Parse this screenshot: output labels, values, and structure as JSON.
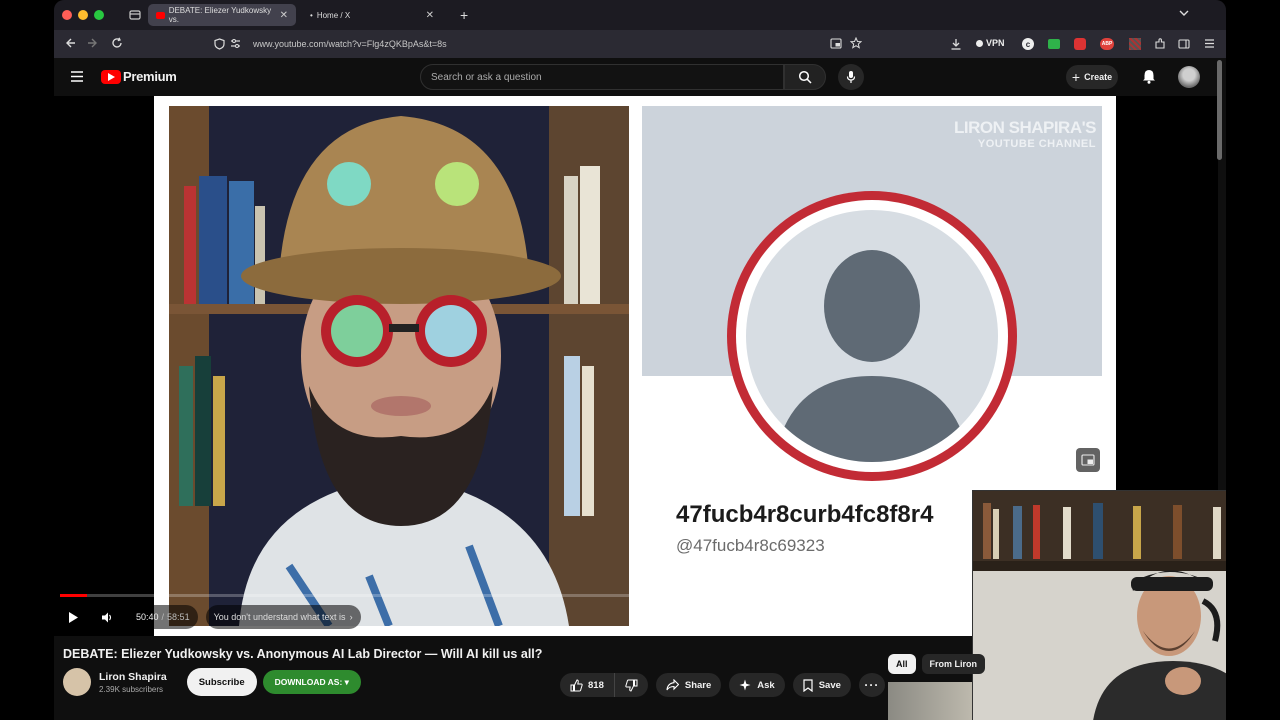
{
  "browser": {
    "tabs": [
      {
        "label": "DEBATE: Eliezer Yudkowsky vs.",
        "active": true
      },
      {
        "label": "Home / X",
        "active": false
      }
    ],
    "url": "www.youtube.com/watch?v=Flg4zQKBpAs&t=8s",
    "vpn_label": "VPN"
  },
  "youtube": {
    "logo_text": "Premium",
    "search_placeholder": "Search or ask a question",
    "create_label": "Create"
  },
  "video": {
    "watermark_line1": "LIRON SHAPIRA'S",
    "watermark_line2": "YOUTUBE CHANNEL",
    "anon_handle_big": "47fucb4r8curb4fc8f8r4",
    "anon_handle_small": "@47fucb4r8c69323",
    "progress": 0.03,
    "time_current": "50:40",
    "time_total": "58:51",
    "chapter": "You don't understand what text is"
  },
  "info": {
    "title": "DEBATE: Eliezer Yudkowsky vs. Anonymous AI Lab Director — Will AI kill us all?",
    "channel_name": "Liron Shapira",
    "subscribers": "2.39K subscribers",
    "subscribe_label": "Subscribe",
    "download_label": "DOWNLOAD AS: ▾",
    "likes": "818",
    "share_label": "Share",
    "ask_label": "Ask",
    "save_label": "Save"
  },
  "chips": [
    "All",
    "From Liron"
  ],
  "colors": {
    "accent": "#ff0000",
    "download_green": "#2e8b2e"
  }
}
